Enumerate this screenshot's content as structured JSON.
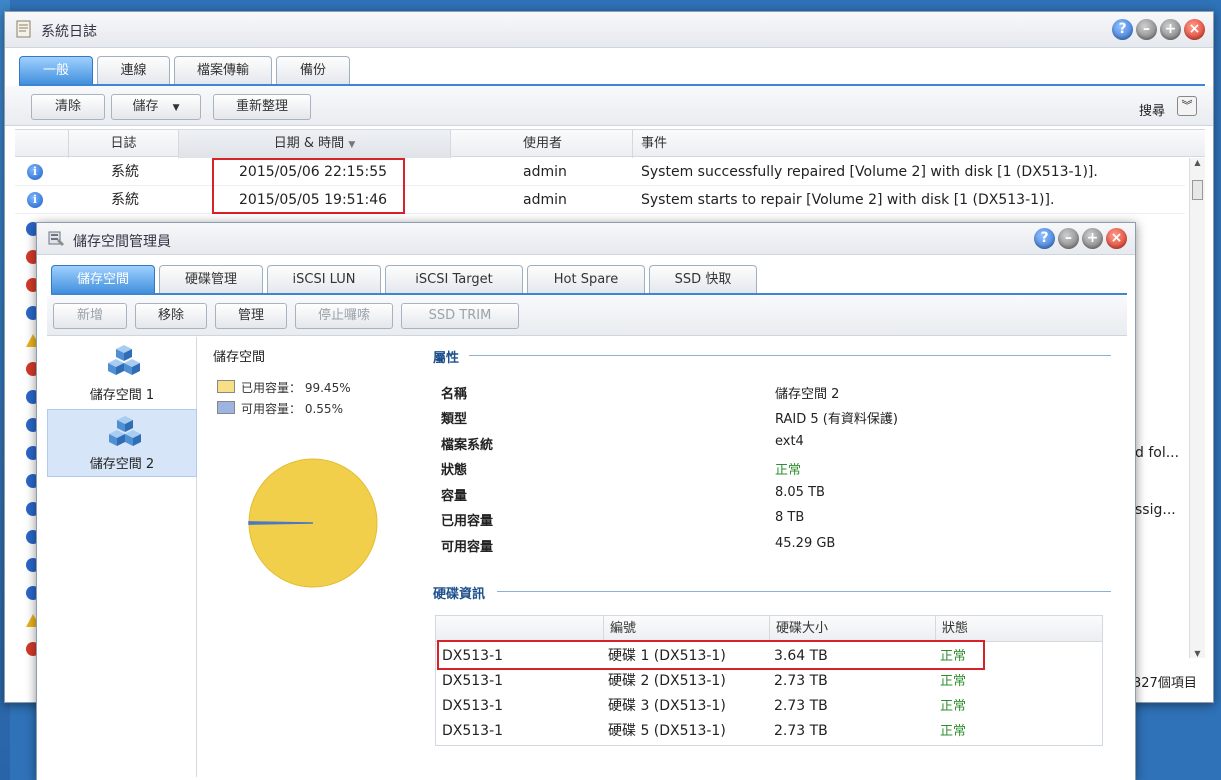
{
  "log_window": {
    "title": "系統日誌",
    "tabs": [
      {
        "label": "一般"
      },
      {
        "label": "連線"
      },
      {
        "label": "檔案傳輸"
      },
      {
        "label": "備份"
      }
    ],
    "toolbar": {
      "clear": "清除",
      "save": "儲存",
      "refresh": "重新整理",
      "search": "搜尋"
    },
    "columns": {
      "log": "日誌",
      "datetime": "日期 & 時間",
      "user": "使用者",
      "event": "事件"
    },
    "rows": [
      {
        "log": "系統",
        "datetime": "2015/05/06 22:15:55",
        "user": "admin",
        "event": "System successfully repaired [Volume 2] with disk [1 (DX513-1)]."
      },
      {
        "log": "系統",
        "datetime": "2015/05/05 19:51:46",
        "user": "admin",
        "event": "System starts to repair [Volume 2] with disk [1 (DX513-1)]."
      }
    ],
    "partial_texts": [
      "d fol...",
      "ssig..."
    ],
    "footer_count": "327個項目"
  },
  "storage_window": {
    "title": "儲存空間管理員",
    "tabs": [
      {
        "label": "儲存空間"
      },
      {
        "label": "硬碟管理"
      },
      {
        "label": "iSCSI LUN"
      },
      {
        "label": "iSCSI Target"
      },
      {
        "label": "Hot Spare"
      },
      {
        "label": "SSD 快取"
      }
    ],
    "toolbar": {
      "create": "新增",
      "remove": "移除",
      "manage": "管理",
      "stop_scrub": "停止囉嗦",
      "ssd_trim": "SSD TRIM"
    },
    "volumes": [
      {
        "label": "儲存空間 1"
      },
      {
        "label": "儲存空間 2"
      }
    ],
    "usage": {
      "title": "儲存空間",
      "used_label": "已用容量：",
      "used_percent": "99.45%",
      "free_label": "可用容量：",
      "free_percent": "0.55%",
      "used_fraction": 0.9945,
      "used_color": "#f2cf4a",
      "free_color": "#4b77c4"
    },
    "properties": {
      "title": "屬性",
      "items": [
        {
          "label": "名稱",
          "value": "儲存空間 2"
        },
        {
          "label": "類型",
          "value": "RAID 5 (有資料保護)"
        },
        {
          "label": "檔案系統",
          "value": "ext4"
        },
        {
          "label": "狀態",
          "value": "正常"
        },
        {
          "label": "容量",
          "value": "8.05 TB"
        },
        {
          "label": "已用容量",
          "value": "8 TB"
        },
        {
          "label": "可用容量",
          "value": "45.29 GB"
        }
      ]
    },
    "disks": {
      "title": "硬碟資訊",
      "columns": {
        "device": "",
        "number": "編號",
        "size": "硬碟大小",
        "status": "狀態"
      },
      "rows": [
        {
          "device": "DX513-1",
          "number": "硬碟 1 (DX513-1)",
          "size": "3.64 TB",
          "status": "正常"
        },
        {
          "device": "DX513-1",
          "number": "硬碟 2 (DX513-1)",
          "size": "2.73 TB",
          "status": "正常"
        },
        {
          "device": "DX513-1",
          "number": "硬碟 3 (DX513-1)",
          "size": "2.73 TB",
          "status": "正常"
        },
        {
          "device": "DX513-1",
          "number": "硬碟 5 (DX513-1)",
          "size": "2.73 TB",
          "status": "正常"
        }
      ]
    }
  }
}
